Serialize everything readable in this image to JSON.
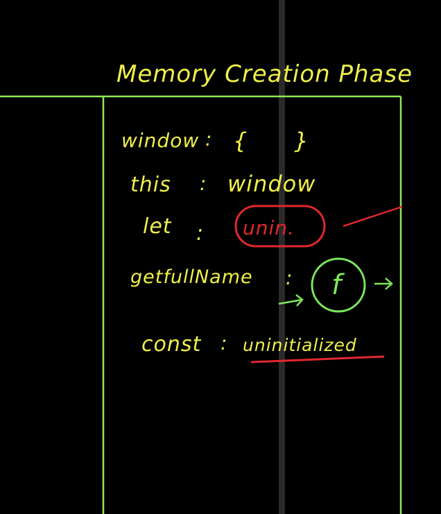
{
  "title": "Memory Creation Phase",
  "entries": [
    {
      "key": "window",
      "sep": ":",
      "value": "{      }"
    },
    {
      "key": "this",
      "sep": ":",
      "value": "window"
    },
    {
      "key": "let",
      "sep": ":",
      "value": "unin."
    },
    {
      "key": "getfullName",
      "sep": ":",
      "value": "f"
    },
    {
      "key": "const",
      "sep": ":",
      "value": "uninitialized"
    }
  ],
  "colors": {
    "background": "#000000",
    "box": "#8fea58",
    "text": "#f0f04a",
    "green_ink": "#7be85a",
    "red_ink": "#e0282c",
    "divider": "#2a2a2a"
  }
}
